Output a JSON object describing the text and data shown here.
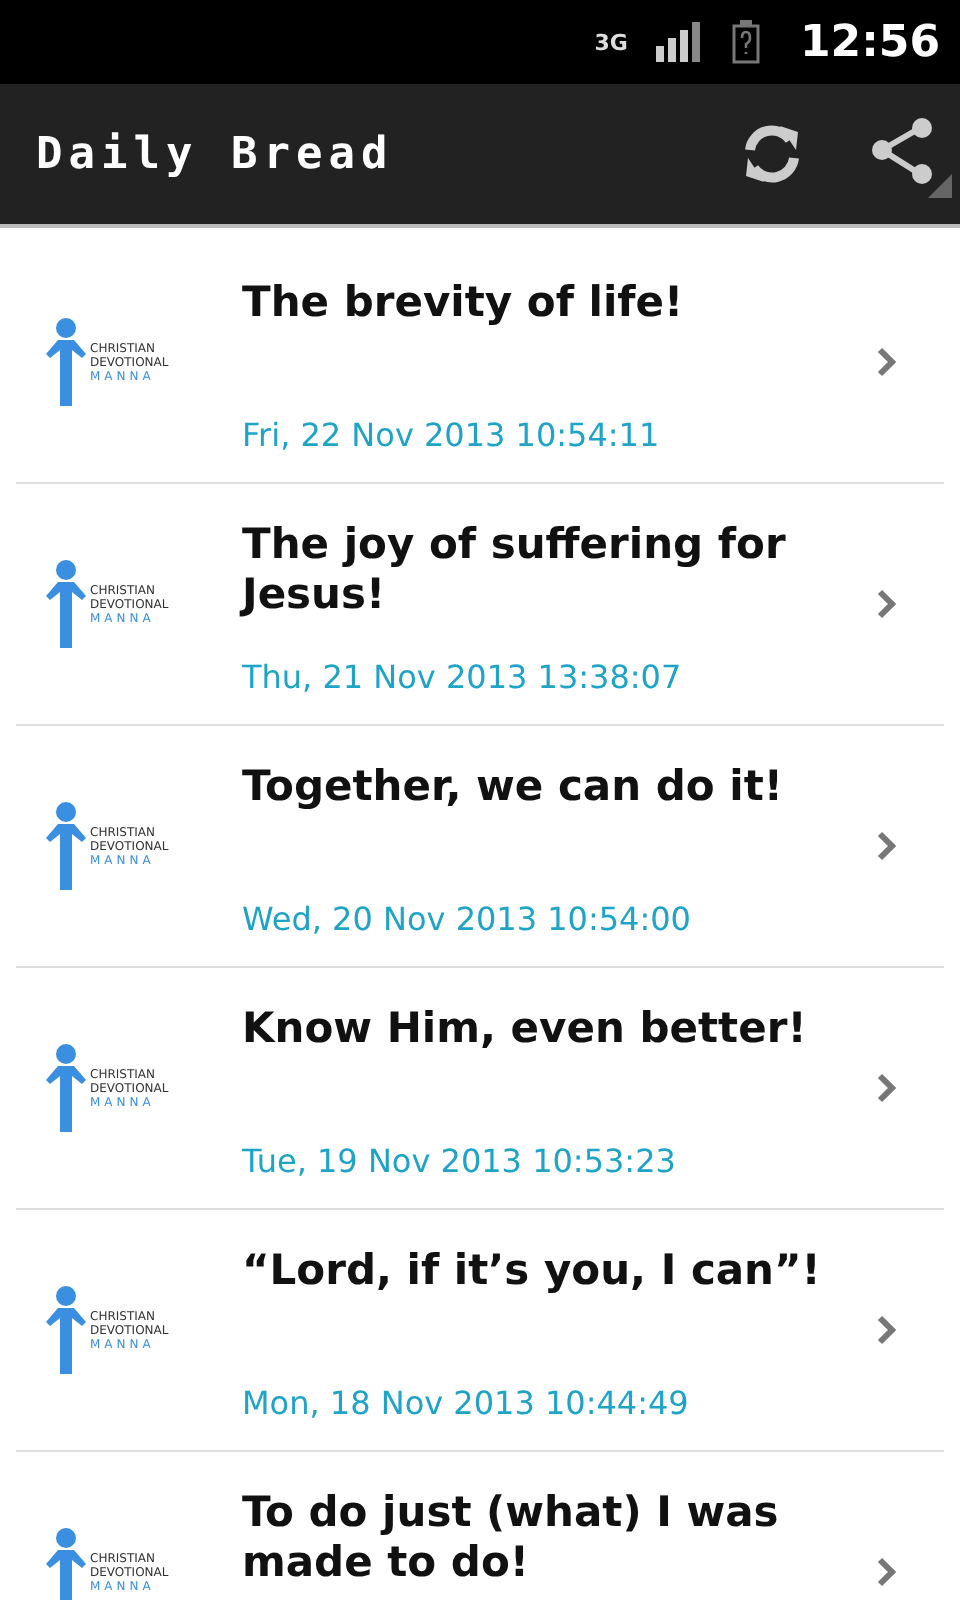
{
  "status_bar": {
    "network": "3G",
    "time": "12:56"
  },
  "action_bar": {
    "title": "Daily Bread"
  },
  "items": [
    {
      "logo": [
        "CHRISTIAN",
        "DEVOTIONAL",
        "MANNA"
      ],
      "title": "The brevity of life!",
      "date": "Fri, 22 Nov 2013 10:54:11"
    },
    {
      "logo": [
        "CHRISTIAN",
        "DEVOTIONAL",
        "MANNA"
      ],
      "title": "The joy of suffering for Jesus!",
      "date": "Thu, 21 Nov 2013 13:38:07"
    },
    {
      "logo": [
        "CHRISTIAN",
        "DEVOTIONAL",
        "MANNA"
      ],
      "title": "Together, we can do it!",
      "date": "Wed, 20 Nov 2013 10:54:00"
    },
    {
      "logo": [
        "CHRISTIAN",
        "DEVOTIONAL",
        "MANNA"
      ],
      "title": "Know Him, even better!",
      "date": "Tue, 19 Nov 2013 10:53:23"
    },
    {
      "logo": [
        "CHRISTIAN",
        "DEVOTIONAL",
        "MANNA"
      ],
      "title": "“Lord, if it’s you, I can”!",
      "date": "Mon, 18 Nov 2013 10:44:49"
    },
    {
      "logo": [
        "CHRISTIAN",
        "DEVOTIONAL",
        "MANNA"
      ],
      "title": "To do just (what) I was made to do!"
    }
  ]
}
